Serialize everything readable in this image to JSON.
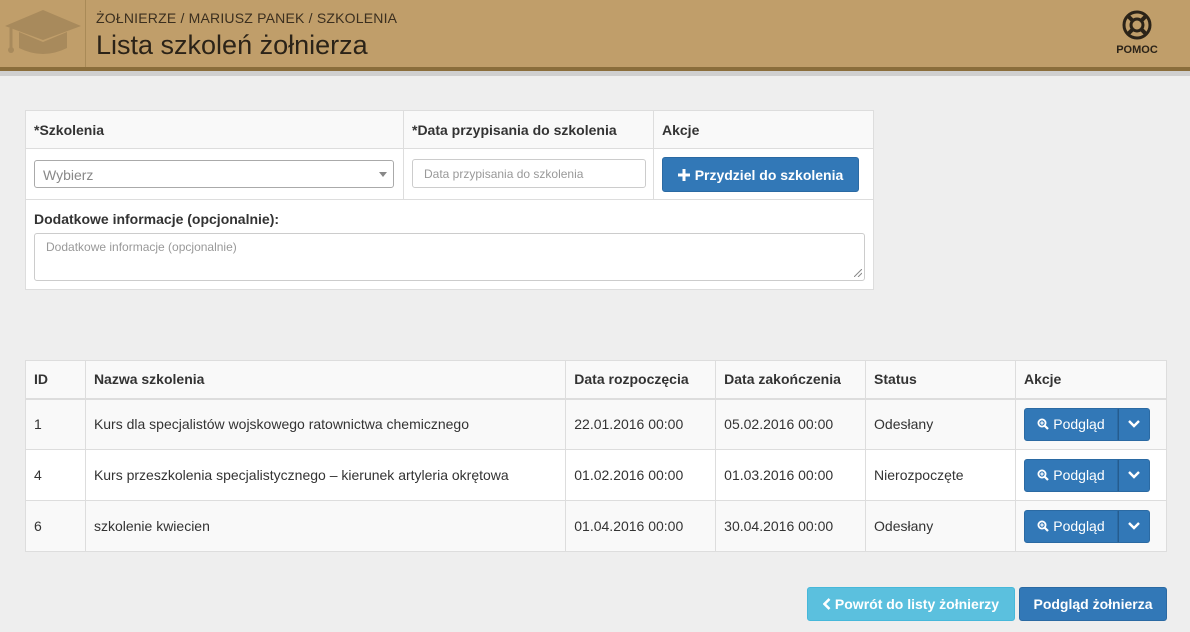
{
  "header": {
    "breadcrumb": "ŻOŁNIERZE / MARIUSZ PANEK / SZKOLENIA",
    "title": "Lista szkoleń żołnierza",
    "help_label": "POMOC"
  },
  "form": {
    "col_training": "*Szkolenia",
    "col_date": "*Data przypisania do szkolenia",
    "col_actions": "Akcje",
    "select_placeholder": "Wybierz",
    "date_placeholder": "Data przypisania do szkolenia",
    "assign_button": "Przydziel do szkolenia",
    "extra_label": "Dodatkowe informacje (opcjonalnie):",
    "extra_placeholder": "Dodatkowe informacje (opcjonalnie)"
  },
  "table": {
    "headers": [
      "ID",
      "Nazwa szkolenia",
      "Data rozpoczęcia",
      "Data zakończenia",
      "Status",
      "Akcje"
    ],
    "rows": [
      {
        "id": "1",
        "name": "Kurs dla specjalistów wojskowego ratownictwa chemicznego",
        "start": "22.01.2016 00:00",
        "end": "05.02.2016 00:00",
        "status": "Odesłany",
        "status_color": "#f0891b"
      },
      {
        "id": "4",
        "name": "Kurs przeszkolenia specjalistycznego – kierunek artyleria okrętowa",
        "start": "01.02.2016 00:00",
        "end": "01.03.2016 00:00",
        "status": "Nierozpoczęte",
        "status_color": "#2020cc"
      },
      {
        "id": "6",
        "name": "szkolenie kwiecien",
        "start": "01.04.2016 00:00",
        "end": "30.04.2016 00:00",
        "status": "Odesłany",
        "status_color": "#f0891b"
      }
    ],
    "view_button": "Podgląd"
  },
  "footer": {
    "back_button": "Powrót do listy żołnierzy",
    "soldier_button": "Podgląd żołnierza"
  },
  "colors": {
    "header_bg": "#c09e6a",
    "primary": "#3278b7",
    "info": "#5bc0de"
  }
}
